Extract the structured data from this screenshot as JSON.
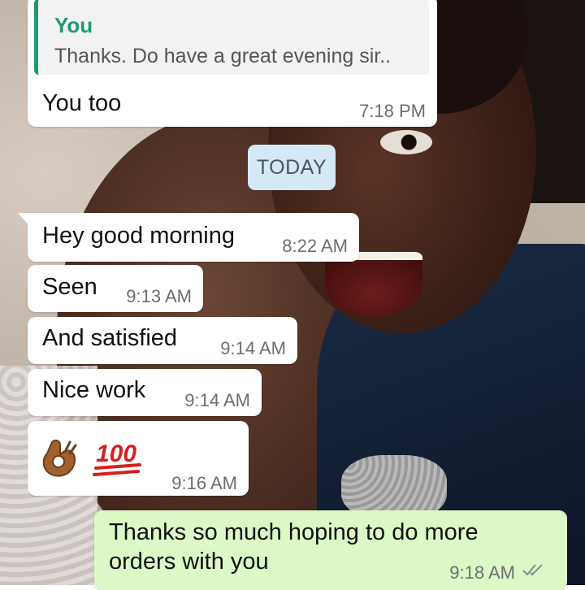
{
  "chat": {
    "reply": {
      "quote_author": "You",
      "quote_text": "Thanks. Do have a great evening sir..",
      "text": "You too",
      "time": "7:18 PM"
    },
    "date_divider": "TODAY",
    "messages": [
      {
        "text": "Hey good morning",
        "time": "8:22 AM"
      },
      {
        "text": "Seen",
        "time": "9:13 AM"
      },
      {
        "text": "And satisfied",
        "time": "9:14 AM"
      },
      {
        "text": "Nice work",
        "time": "9:14 AM"
      }
    ],
    "emoji_message": {
      "emojis": [
        "ok-hand-emoji",
        "hundred-points-emoji"
      ],
      "time": "9:16 AM"
    },
    "sent": {
      "line1": "Thanks so much hoping to do more",
      "line2": "orders with you",
      "time": "9:18 AM",
      "status_icon": "double-check-icon"
    }
  },
  "colors": {
    "incoming_bubble": "#ffffff",
    "outgoing_bubble": "#dcf8c6",
    "quote_accent": "#1e9a78",
    "date_chip": "#d4e9f5",
    "timestamp": "#6e6e6e"
  }
}
